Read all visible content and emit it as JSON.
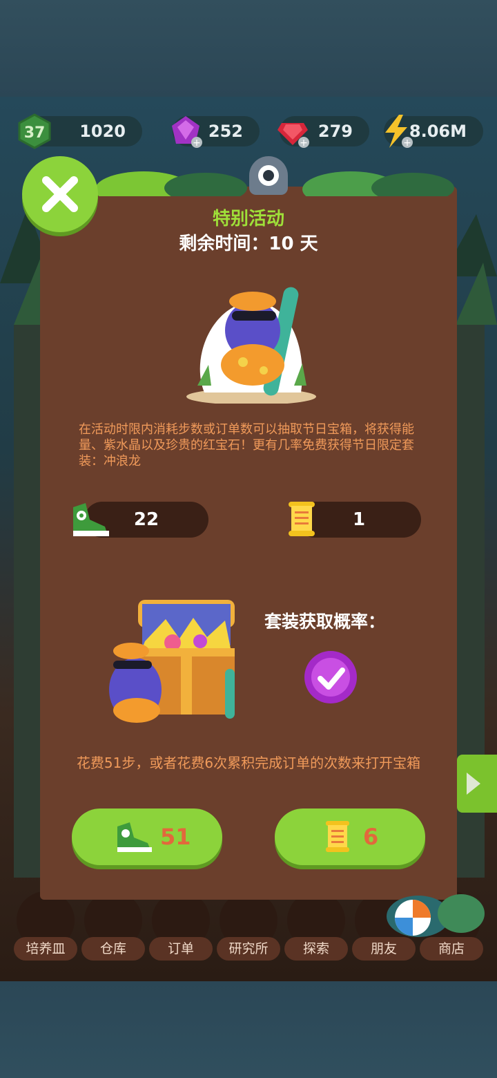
{
  "top_bar": {
    "level": "37",
    "experience": "1020",
    "purple_gems": "252",
    "red_gems": "279",
    "energy": "8.06M"
  },
  "dialog": {
    "title": "特别活动",
    "remaining_time": "剩余时间：10 天",
    "description": "在活动时限内消耗步数或订单数可以抽取节日宝箱，将获得能量、紫水晶以及珍贵的红宝石！更有几率免费获得节日限定套装：冲浪龙",
    "steps_count": "22",
    "orders_count": "1",
    "rate_label": "套装获取概率：",
    "cost_text": "花费51步，或者花费6次累积完成订单的次数来打开宝箱",
    "steps_button_value": "51",
    "orders_button_value": "6"
  },
  "nav": [
    {
      "label": "培养皿"
    },
    {
      "label": "仓库"
    },
    {
      "label": "订单"
    },
    {
      "label": "研究所"
    },
    {
      "label": "探索"
    },
    {
      "label": "朋友"
    },
    {
      "label": "商店"
    }
  ],
  "colors": {
    "accent_green": "#8cd33b",
    "panel_brown": "#6b3f2c",
    "title_green": "#9fe039",
    "description_orange": "#f09a5a"
  }
}
